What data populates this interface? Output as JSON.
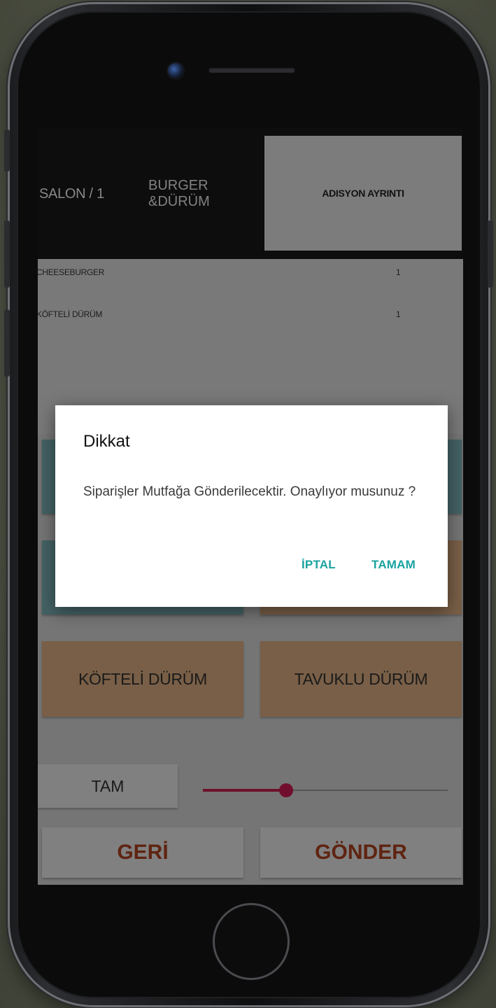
{
  "header": {
    "table": "SALON / 1",
    "category": "BURGER\n&DÜRÜM",
    "detail_button": "ADISYON AYRINTI"
  },
  "order_items": [
    {
      "name": "CHEESEBURGER",
      "qty": "1"
    },
    {
      "name": "KÖFTELİ DÜRÜM",
      "qty": "1"
    }
  ],
  "products": [
    {
      "label": "KÖFTELİ DÜRÜM"
    },
    {
      "label": "TAVUKLU DÜRÜM"
    }
  ],
  "portion": {
    "label": "TAM",
    "slider_value_fraction": 0.34
  },
  "actions": {
    "back": "GERİ",
    "send": "GÖNDER"
  },
  "dialog": {
    "title": "Dikkat",
    "message": "Siparişler Mutfağa Gönderilecektir. Onaylıyor musunuz ?",
    "cancel": "İPTAL",
    "ok": "TAMAM"
  },
  "colors": {
    "accent": "#18a3a0",
    "slider": "#b8174a",
    "tile_teal": "#6f9ea4",
    "tile_tan": "#c39a73",
    "action_text": "#9a3a1c"
  }
}
